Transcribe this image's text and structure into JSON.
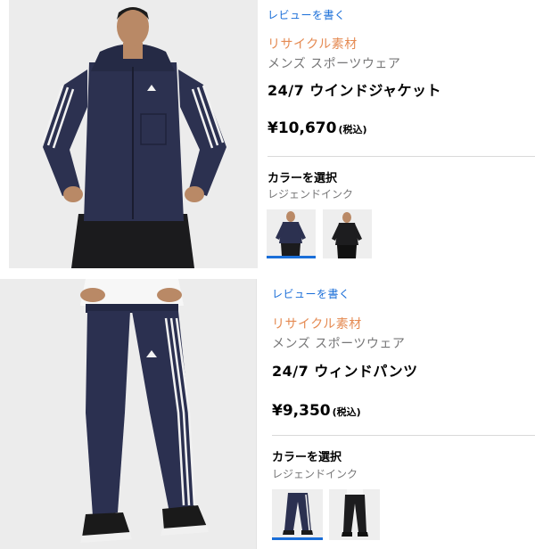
{
  "products": [
    {
      "review_link": "レビューを書く",
      "recycled_tag": "リサイクル素材",
      "category": "メンズ スポーツウェア",
      "name": "24/7 ウインドジャケット",
      "price": "¥10,670",
      "tax_note": "(税込)",
      "color_label": "カラーを選択",
      "color_name": "レジェンドインク",
      "swatches": [
        "レジェンドインク",
        "ブラック"
      ]
    },
    {
      "review_link": "レビューを書く",
      "recycled_tag": "リサイクル素材",
      "category": "メンズ スポーツウェア",
      "name": "24/7 ウィンドパンツ",
      "price": "¥9,350",
      "tax_note": "(税込)",
      "color_label": "カラーを選択",
      "color_name": "レジェンドインク",
      "swatches": [
        "レジェンドインク",
        "ブラック"
      ]
    }
  ],
  "colors": {
    "link": "#1a6ed8",
    "recycled": "#e58a52",
    "muted": "#767677",
    "product_navy": "#2b3050",
    "selected_underline": "#1a6ed8"
  }
}
